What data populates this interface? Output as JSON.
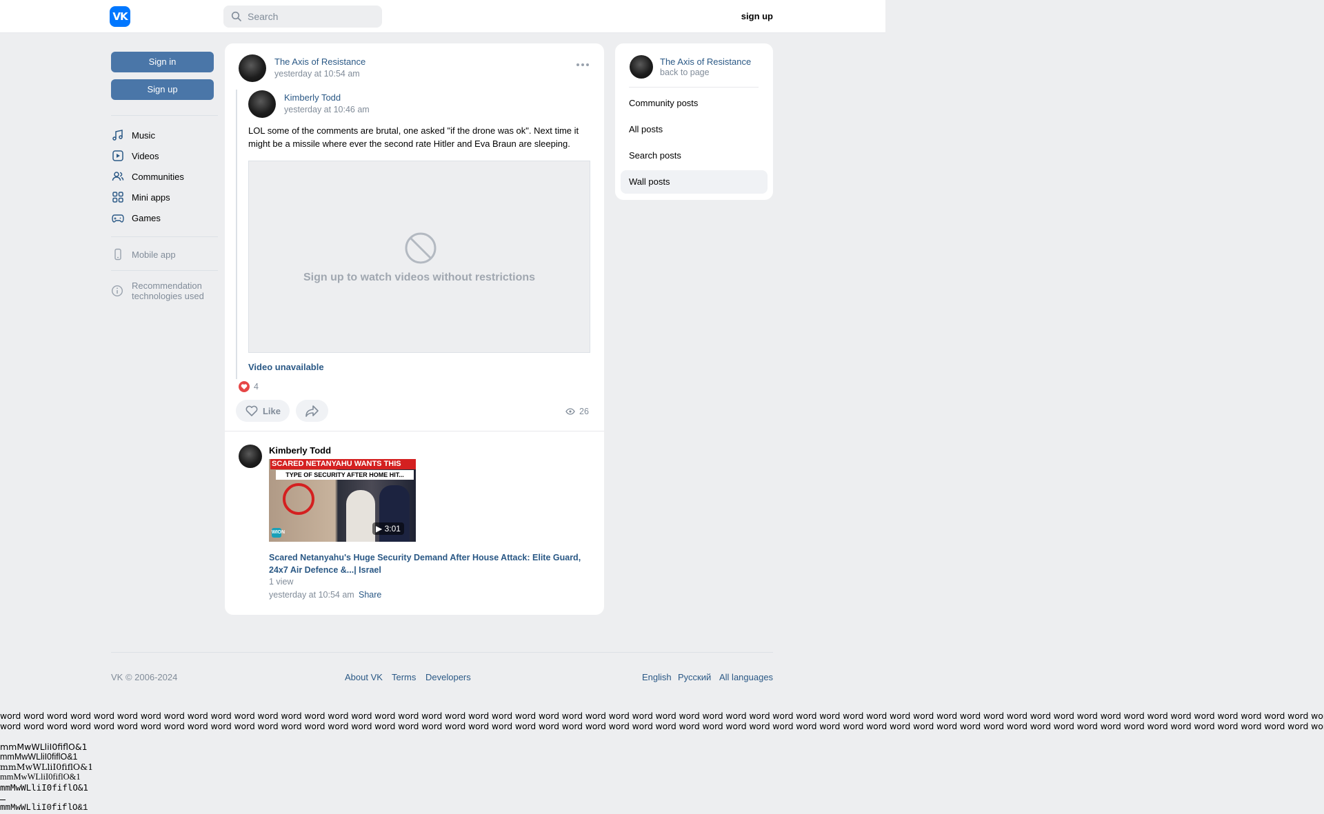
{
  "header": {
    "logo_text": "VK",
    "search_placeholder": "Search",
    "signup_label": "sign up"
  },
  "sidebar": {
    "signin_label": "Sign in",
    "signup_label": "Sign up",
    "items": [
      {
        "label": "Music",
        "icon": "music-note-icon"
      },
      {
        "label": "Videos",
        "icon": "video-icon"
      },
      {
        "label": "Communities",
        "icon": "users-icon"
      },
      {
        "label": "Mini apps",
        "icon": "grid-icon"
      },
      {
        "label": "Games",
        "icon": "gamepad-icon"
      }
    ],
    "mobile_app": "Mobile app",
    "recommendation": "Recommendation technologies used"
  },
  "post": {
    "author": "The Axis of Resistance",
    "time": "yesterday at 10:54 am",
    "repost": {
      "author": "Kimberly Todd",
      "time": "yesterday at 10:46 am",
      "text": "LOL some of the comments are brutal, one asked \"if the drone was ok\". Next time it might be a missile where ever the second rate Hitler and Eva Braun are sleeping.",
      "video_message": "Sign up to watch videos without restrictions",
      "video_unavailable": "Video unavailable"
    },
    "likes_count": "4",
    "like_label": "Like",
    "views_count": "26"
  },
  "attached_video": {
    "author": "Kimberly Todd",
    "thumb_banner": "SCARED NETANYAHU WANTS THIS",
    "thumb_subbanner": "TYPE OF SECURITY AFTER HOME HIT...",
    "thumb_logo": "WION",
    "duration": "3:01",
    "title": "Scared Netanyahu's Huge Security Demand After House Attack: Elite Guard, 24x7 Air Defence &...| Israel",
    "views": "1 view",
    "time": "yesterday at 10:54 am",
    "share_label": "Share"
  },
  "right_panel": {
    "author": "The Axis of Resistance",
    "back": "back to page",
    "items": [
      "Community posts",
      "All posts",
      "Search posts",
      "Wall posts"
    ],
    "active_item": "Wall posts"
  },
  "footer": {
    "copyright": "VK © 2006-2024",
    "links": [
      "About VK",
      "Terms",
      "Developers"
    ],
    "languages": [
      "English",
      "Русский",
      "All languages"
    ]
  },
  "test_text": {
    "word_line": "word word word word word word word word word word word word word word word word word word word word word word word word word word word word word word word word word word word word word word word word word word word word word word word word word word word word word word word word word word word word word word word word word word word word word word word word word word",
    "glyph_line": "mmMwWLliI0fiflO&1"
  },
  "colors": {
    "accent": "#4a76a8",
    "link": "#2a5885",
    "vk_blue": "#0077ff",
    "like_red": "#e64646"
  }
}
